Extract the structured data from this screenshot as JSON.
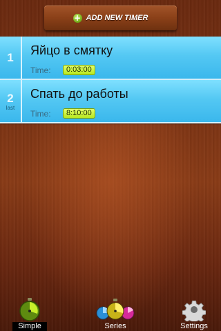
{
  "header": {
    "add_timer_label": "ADD NEW TIMER"
  },
  "timers": [
    {
      "index": "1",
      "tag": "",
      "name": "Яйцо в смятку",
      "time_label": "Time:",
      "time_value": "0:03:00"
    },
    {
      "index": "2",
      "tag": "last",
      "name": "Спать до работы",
      "time_label": "Time:",
      "time_value": "8:10:00"
    }
  ],
  "tabs": [
    {
      "label": "Simple",
      "icon": "green-timer-icon",
      "selected": true
    },
    {
      "label": "Series",
      "icon": "series-timers-icon",
      "selected": false
    },
    {
      "label": "Settings",
      "icon": "gear-icon",
      "selected": false
    }
  ],
  "colors": {
    "row_blue": "#54c8f3",
    "time_badge": "#c8f02a",
    "wood": "#7d3414"
  }
}
